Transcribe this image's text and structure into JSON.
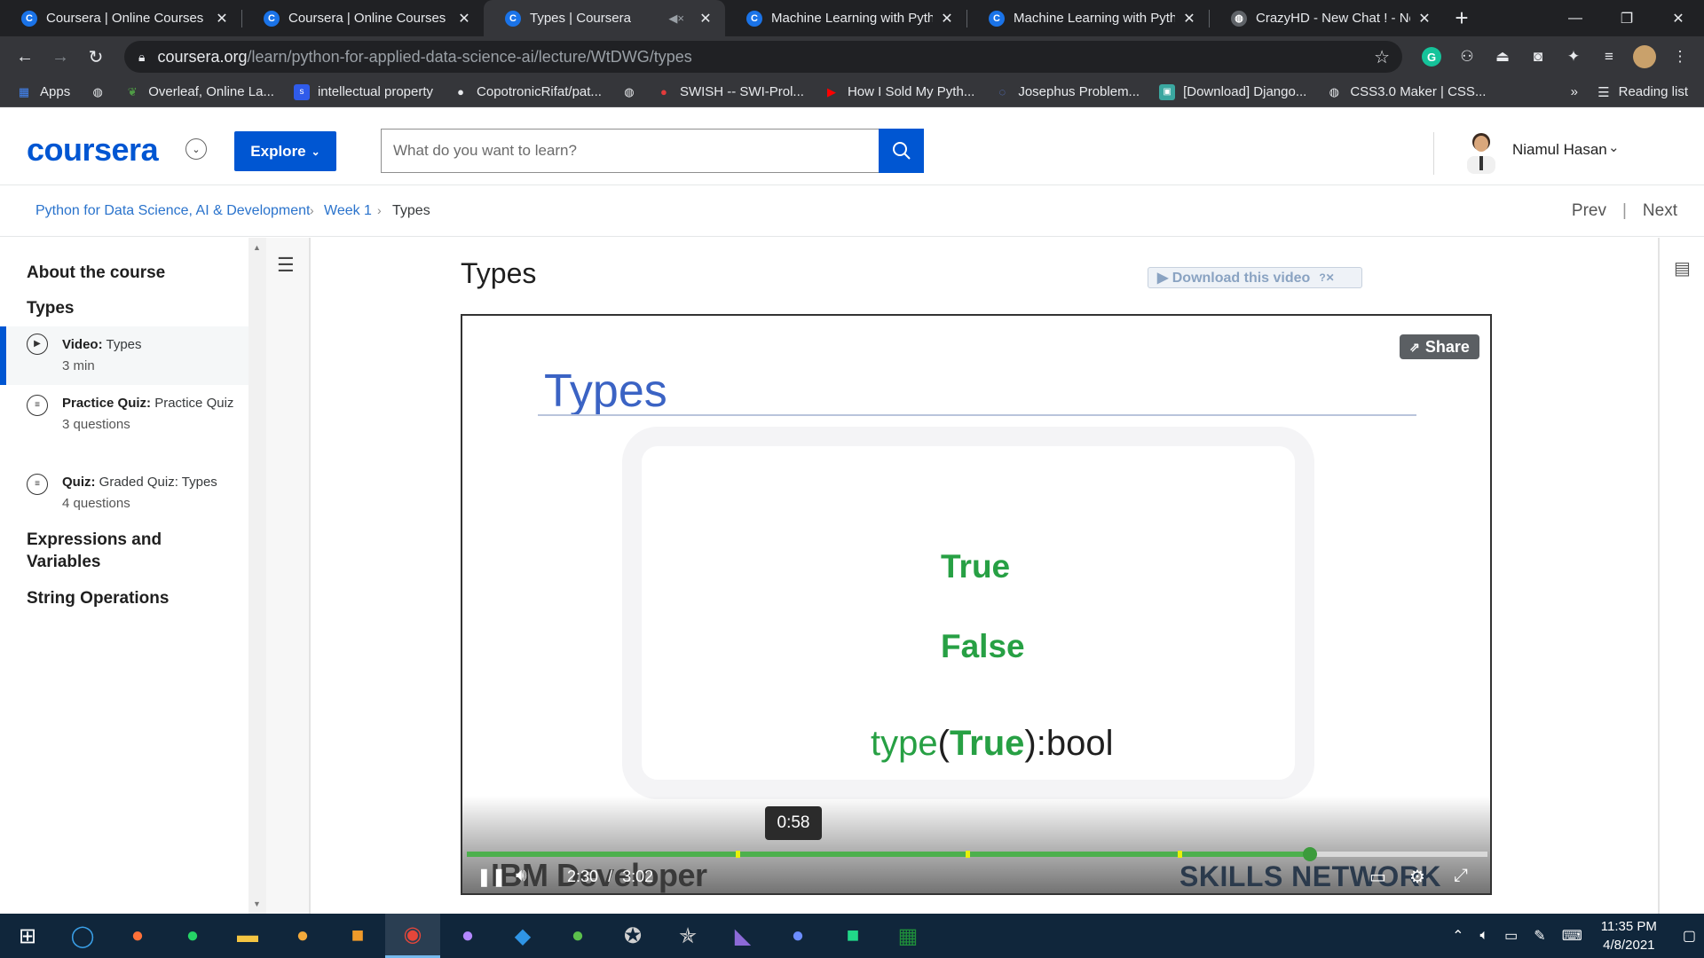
{
  "browser": {
    "tabs": [
      {
        "title": "Coursera | Online Courses & Credentials",
        "favicon": "C",
        "active": false,
        "muted": false
      },
      {
        "title": "Coursera | Online Courses & Credentials",
        "favicon": "C",
        "active": false,
        "muted": false
      },
      {
        "title": "Types | Coursera",
        "favicon": "C",
        "active": true,
        "muted": true
      },
      {
        "title": "Machine Learning with Python",
        "favicon": "C",
        "active": false,
        "muted": false
      },
      {
        "title": "Machine Learning with Python",
        "favicon": "C",
        "active": false,
        "muted": false
      },
      {
        "title": "CrazyHD - New Chat ! - New",
        "favicon": "globe",
        "active": false,
        "muted": false
      }
    ],
    "url_domain": "coursera.org",
    "url_path": "/learn/python-for-applied-data-science-ai/lecture/WtDWG/types",
    "bookmarks": [
      {
        "label": "Apps",
        "icon": "apps-grid-icon",
        "color": "#4285f4"
      },
      {
        "label": "",
        "icon": "globe-icon",
        "color": "#9aa0a6"
      },
      {
        "label": "Overleaf, Online La...",
        "icon": "overleaf-leaf-icon",
        "color": "#4f9c45"
      },
      {
        "label": "intellectual property",
        "icon": "s-logo-icon",
        "color": "#2f5bea"
      },
      {
        "label": "CopotronicRifat/pat...",
        "icon": "github-icon",
        "color": "#e8eaed"
      },
      {
        "label": "",
        "icon": "globe-icon",
        "color": "#9aa0a6"
      },
      {
        "label": "SWISH -- SWI-Prol...",
        "icon": "swish-owl-icon",
        "color": "#e33b3b"
      },
      {
        "label": "How I Sold My Pyth...",
        "icon": "youtube-icon",
        "color": "#ff0000"
      },
      {
        "label": "Josephus Problem...",
        "icon": "loading-circle-icon",
        "color": "#5a7dd9"
      },
      {
        "label": "[Download] Django...",
        "icon": "django-book-icon",
        "color": "#3aa7a0"
      },
      {
        "label": "CSS3.0 Maker | CSS...",
        "icon": "globe-icon",
        "color": "#9aa0a6"
      }
    ],
    "reading_list": "Reading list"
  },
  "header": {
    "logo": "coursera",
    "explore": "Explore",
    "search_placeholder": "What do you want to learn?",
    "user_name": "Niamul Hasan"
  },
  "breadcrumb": {
    "course": "Python for Data Science, AI & Development",
    "week": "Week 1",
    "current": "Types",
    "prev": "Prev",
    "next": "Next"
  },
  "sidebar": {
    "about": "About the course",
    "section": "Types",
    "items": [
      {
        "kind": "Video:",
        "title": "Types",
        "meta": "3 min",
        "active": true,
        "icon": "play-circle-icon"
      },
      {
        "kind": "Practice Quiz:",
        "title": "Practice Quiz",
        "meta": "3 questions",
        "active": false,
        "icon": "quiz-list-icon"
      },
      {
        "kind": "Quiz:",
        "title": "Graded Quiz: Types",
        "meta": "4 questions",
        "active": false,
        "icon": "quiz-list-icon"
      }
    ],
    "sections_after": [
      "Expressions and Variables",
      "String Operations"
    ]
  },
  "main": {
    "title": "Types",
    "download_badge": "▶ Download this video",
    "video": {
      "share": "Share",
      "slide_title": "Types",
      "line_true": "True",
      "line_false": "False",
      "code_type": "type",
      "code_open": "(",
      "code_arg": "True",
      "code_close": "):bool",
      "hover_time": "0:58",
      "current_time": "2:30",
      "time_sep": "/",
      "duration": "3:02",
      "progress": 0.826,
      "chapter_marks": [
        0.265,
        0.49,
        0.698
      ],
      "brand_left": "IBM Developer",
      "brand_right": "SKILLS NETWORK"
    }
  },
  "taskbar": {
    "time": "11:35 PM",
    "date": "4/8/2021"
  },
  "colors": {
    "coursera_blue": "#0056d2",
    "link_blue": "#2a73cc",
    "slide_green": "#27a044",
    "slide_blue": "#3b63c4"
  }
}
